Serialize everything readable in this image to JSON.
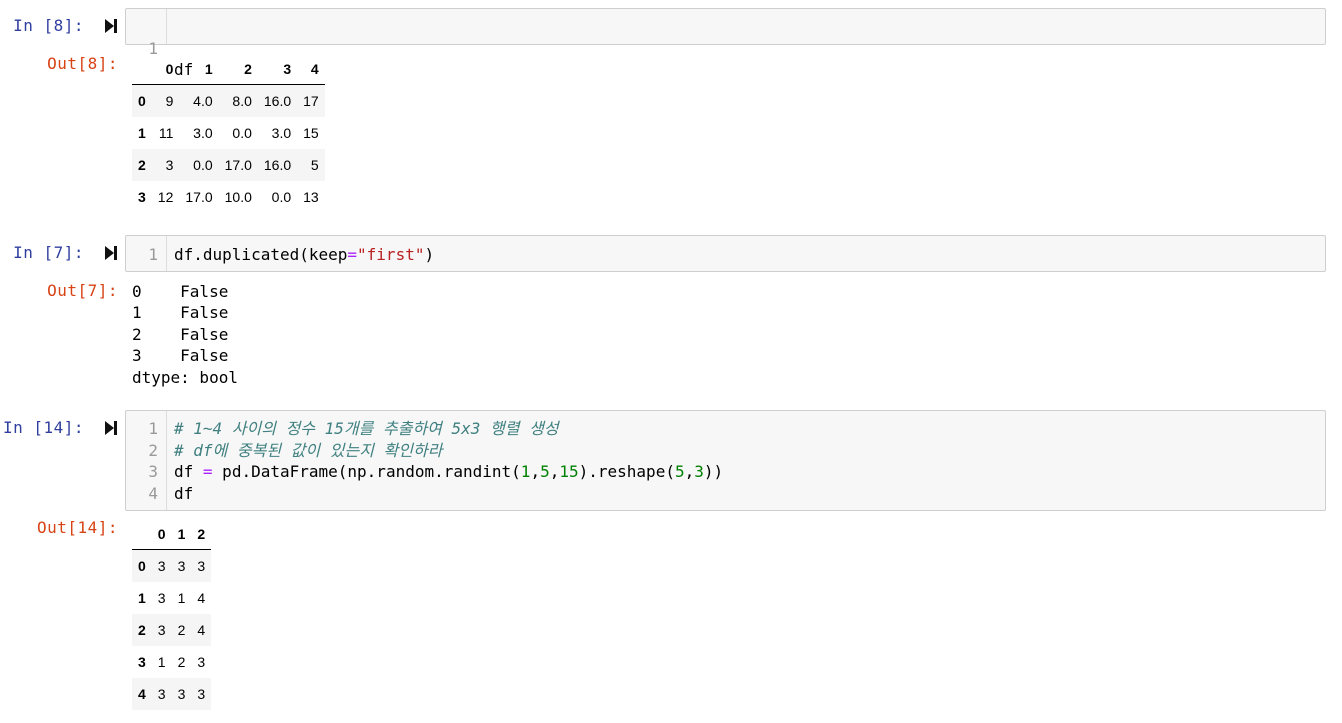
{
  "cells": [
    {
      "in_prompt": "In [8]:",
      "out_prompt": "Out[8]:",
      "code_lines": [
        {
          "num": "1",
          "text": "df"
        }
      ],
      "output_table": {
        "columns": [
          "0",
          "1",
          "2",
          "3",
          "4"
        ],
        "rows": [
          {
            "index": "0",
            "values": [
              "9",
              "4.0",
              "8.0",
              "16.0",
              "17"
            ]
          },
          {
            "index": "1",
            "values": [
              "11",
              "3.0",
              "0.0",
              "3.0",
              "15"
            ]
          },
          {
            "index": "2",
            "values": [
              "3",
              "0.0",
              "17.0",
              "16.0",
              "5"
            ]
          },
          {
            "index": "3",
            "values": [
              "12",
              "17.0",
              "10.0",
              "0.0",
              "13"
            ]
          }
        ]
      }
    },
    {
      "in_prompt": "In [7]:",
      "out_prompt": "Out[7]:",
      "code_lines": [
        {
          "num": "1",
          "segments": [
            {
              "t": "df.duplicated(keep",
              "c": ""
            },
            {
              "t": "=",
              "c": "op"
            },
            {
              "t": "\"first\"",
              "c": "str"
            },
            {
              "t": ")",
              "c": ""
            }
          ]
        }
      ],
      "output_text": [
        "0    False",
        "1    False",
        "2    False",
        "3    False",
        "dtype: bool"
      ]
    },
    {
      "in_prompt": "In [14]:",
      "out_prompt": "Out[14]:",
      "code_lines": [
        {
          "num": "1",
          "segments": [
            {
              "t": "# 1~4 사이의 정수 15개를 추출하여 5x3 행렬 생성",
              "c": "comment"
            }
          ]
        },
        {
          "num": "2",
          "segments": [
            {
              "t": "# df에 중복된 값이 있는지 확인하라",
              "c": "comment"
            }
          ]
        },
        {
          "num": "3",
          "segments": [
            {
              "t": "df ",
              "c": ""
            },
            {
              "t": "=",
              "c": "op"
            },
            {
              "t": " pd.DataFrame(np.random.randint(",
              "c": ""
            },
            {
              "t": "1",
              "c": "num"
            },
            {
              "t": ",",
              "c": ""
            },
            {
              "t": "5",
              "c": "num"
            },
            {
              "t": ",",
              "c": ""
            },
            {
              "t": "15",
              "c": "num"
            },
            {
              "t": ").reshape(",
              "c": ""
            },
            {
              "t": "5",
              "c": "num"
            },
            {
              "t": ",",
              "c": ""
            },
            {
              "t": "3",
              "c": "num"
            },
            {
              "t": "))",
              "c": ""
            }
          ]
        },
        {
          "num": "4",
          "segments": [
            {
              "t": "df",
              "c": ""
            }
          ]
        }
      ],
      "output_table": {
        "columns": [
          "0",
          "1",
          "2"
        ],
        "rows": [
          {
            "index": "0",
            "values": [
              "3",
              "3",
              "3"
            ]
          },
          {
            "index": "1",
            "values": [
              "3",
              "1",
              "4"
            ]
          },
          {
            "index": "2",
            "values": [
              "3",
              "2",
              "4"
            ]
          },
          {
            "index": "3",
            "values": [
              "1",
              "2",
              "3"
            ]
          },
          {
            "index": "4",
            "values": [
              "3",
              "3",
              "3"
            ]
          }
        ]
      }
    }
  ],
  "icons": {
    "run_button": "skip-to-end-icon"
  },
  "colors": {
    "in_prompt": "#303f9f",
    "out_prompt": "#d84315",
    "comment": "#408080",
    "operator": "#aa22ff",
    "string": "#ba2121",
    "number": "#008000",
    "input_bg": "#f7f7f7",
    "input_border": "#cfcfcf"
  }
}
